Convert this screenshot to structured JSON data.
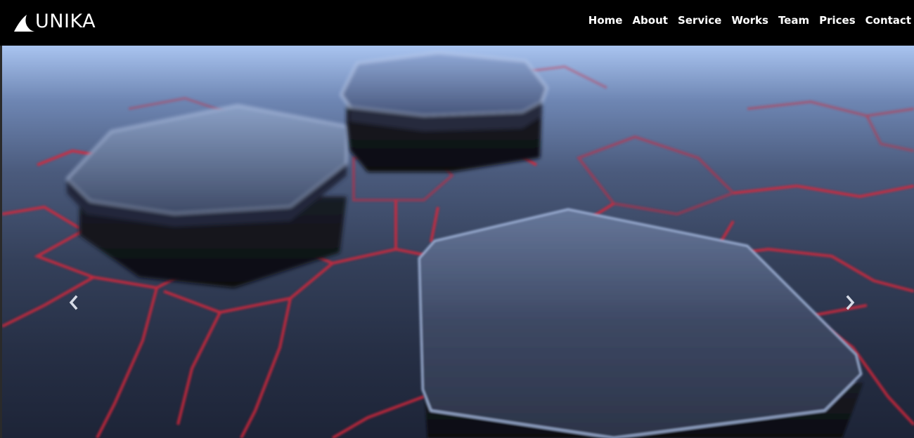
{
  "brand": {
    "name": "UNIKA"
  },
  "nav": {
    "items": [
      {
        "label": "Home"
      },
      {
        "label": "About"
      },
      {
        "label": "Service"
      },
      {
        "label": "Works"
      },
      {
        "label": "Team"
      },
      {
        "label": "Prices"
      },
      {
        "label": "Contact"
      }
    ]
  },
  "carousel": {
    "prev_icon": "chevron-left-icon",
    "next_icon": "chevron-right-icon"
  },
  "colors": {
    "navbar_bg": "#000000",
    "nav_text": "#ffffff",
    "hex_lines": "#d8283a"
  }
}
